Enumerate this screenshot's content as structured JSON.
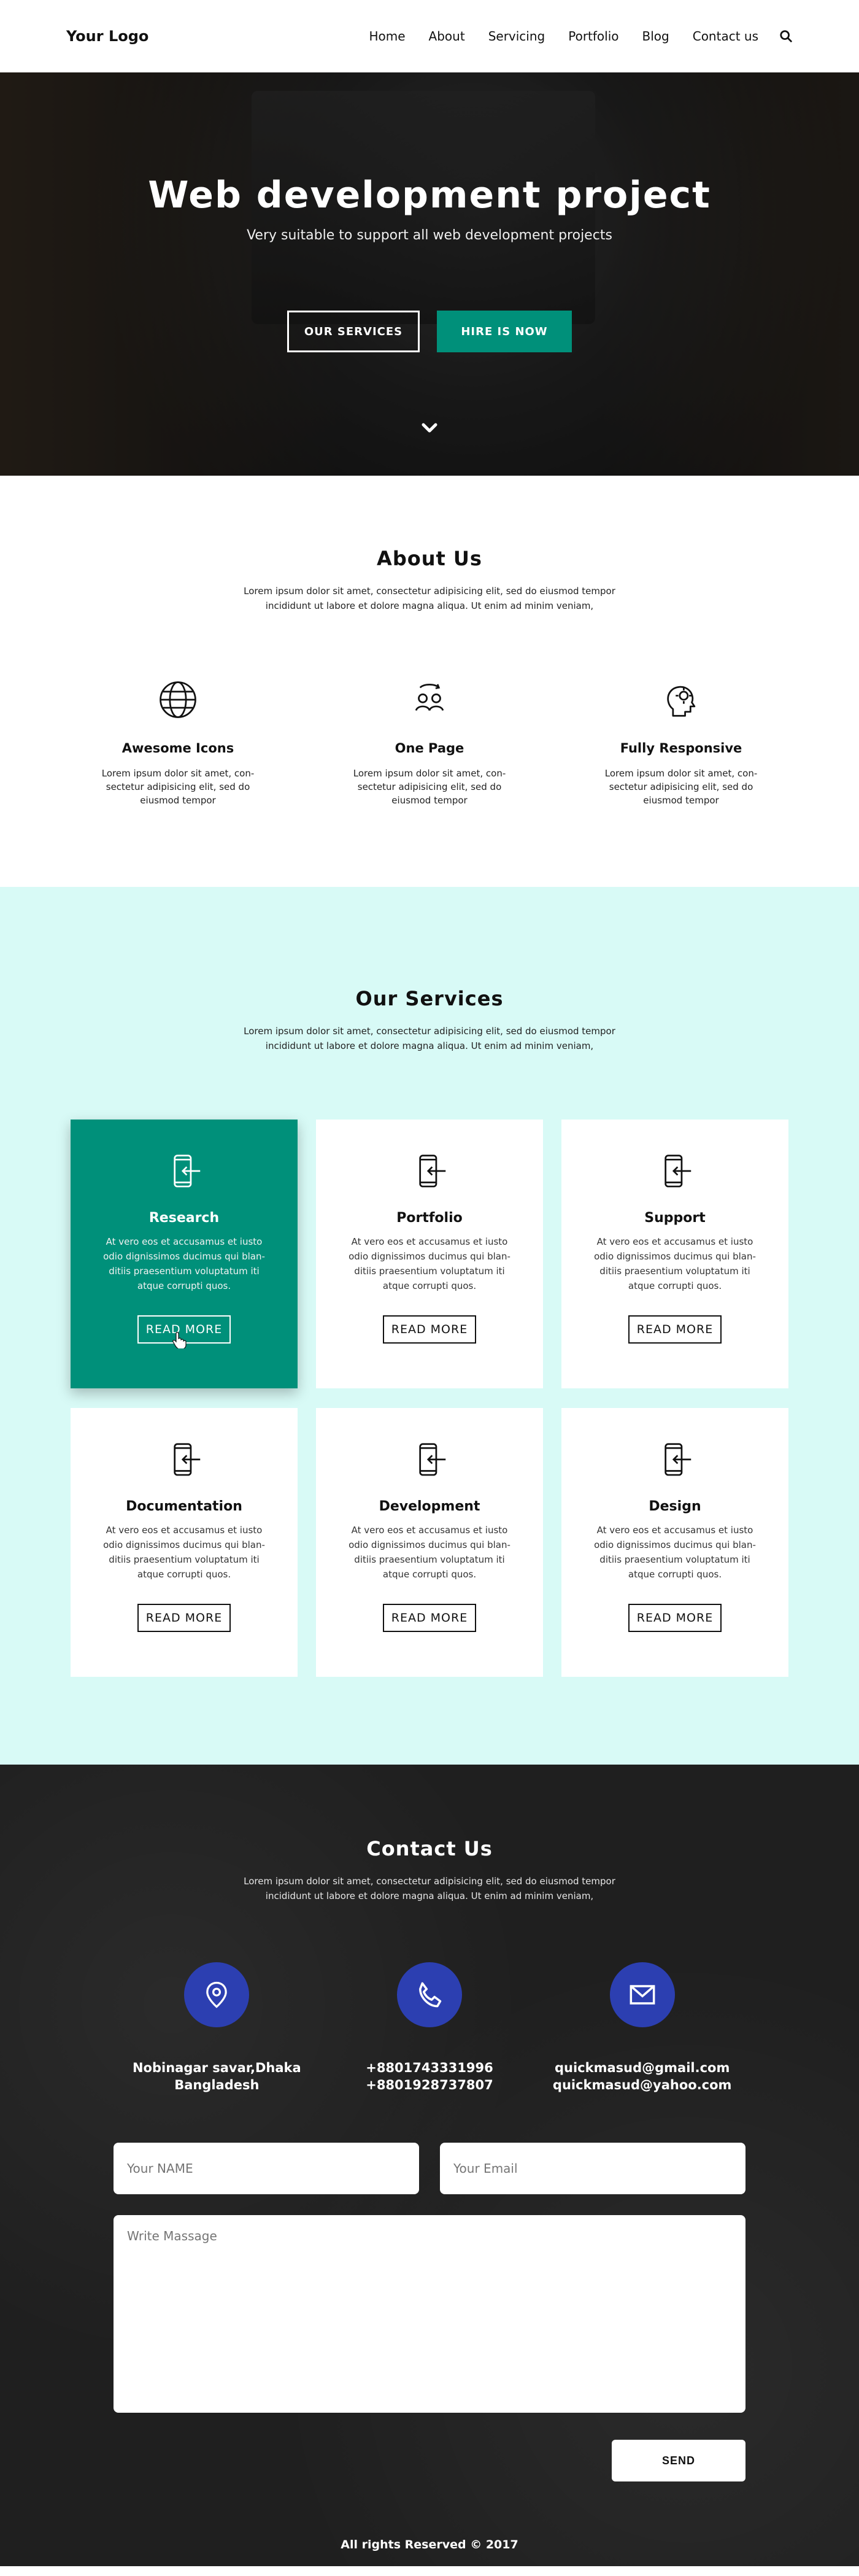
{
  "header": {
    "logo": "Your Logo",
    "nav": [
      "Home",
      "About",
      "Servicing",
      "Portfolio",
      "Blog",
      "Contact us"
    ]
  },
  "hero": {
    "title": "Web development project",
    "subtitle": "Very suitable to support all web development projects",
    "primary_button": "OUR SERVICES",
    "secondary_button": "HIRE IS NOW"
  },
  "about": {
    "title": "About Us",
    "desc": "Lorem ipsum dolor sit amet, consectetur adipisicing elit, sed do eiusmod tempor incididunt ut labore et dolore magna aliqua. Ut enim ad minim veniam,",
    "features": [
      {
        "title": "Awesome Icons",
        "text": "Lorem ipsum dolor sit amet, con-sectetur adipisicing elit, sed do eiusmod tempor",
        "icon": "globe-icon"
      },
      {
        "title": "One Page",
        "text": "Lorem ipsum dolor sit amet, con-sectetur adipisicing elit, sed do eiusmod tempor",
        "icon": "users-sync-icon"
      },
      {
        "title": "Fully Responsive",
        "text": "Lorem ipsum dolor sit amet, con-sectetur adipisicing elit, sed do eiusmod tempor",
        "icon": "head-gear-icon"
      }
    ]
  },
  "services": {
    "title": "Our Services",
    "desc": "Lorem ipsum dolor sit amet, consectetur adipisicing elit, sed do eiusmod tempor incididunt ut labore et dolore magna aliqua. Ut enim ad minim veniam,",
    "card_text": "At vero eos et accusamus et iusto odio dignissimos ducimus qui blan-ditiis praesentium voluptatum iti atque corrupti quos.",
    "read_more": "READ MORE",
    "cards": [
      "Research",
      "Portfolio",
      "Support",
      "Documentation",
      "Development",
      "Design"
    ]
  },
  "contact": {
    "title": "Contact Us",
    "desc": "Lorem ipsum dolor sit amet, consectetur adipisicing elit, sed do eiusmod tempor incididunt ut labore et dolore magna aliqua. Ut enim ad minim veniam,",
    "address": [
      "Nobinagar savar,Dhaka",
      "Bangladesh"
    ],
    "phones": [
      "+8801743331996",
      "+8801928737807"
    ],
    "emails": [
      "quickmasud@gmail.com",
      "quickmasud@yahoo.com"
    ],
    "form": {
      "name_placeholder": "Your NAME",
      "email_placeholder": "Your Email",
      "message_placeholder": "Write Massage",
      "send": "SEND"
    }
  },
  "footer": {
    "copyright": "All rights Reserved © 2017"
  },
  "colors": {
    "teal": "#00907a",
    "light_teal": "#d8faf6",
    "blue": "#2c3fb1",
    "dark": "#1f1f1f"
  }
}
